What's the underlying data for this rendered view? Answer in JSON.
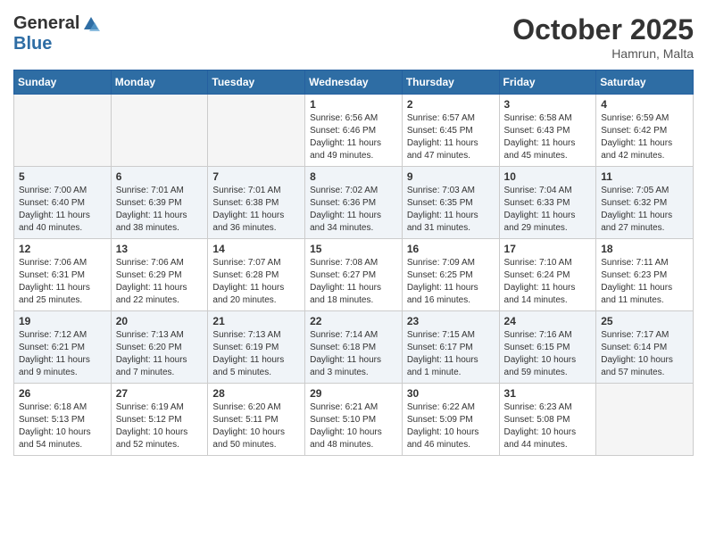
{
  "header": {
    "logo_general": "General",
    "logo_blue": "Blue",
    "month": "October 2025",
    "location": "Hamrun, Malta"
  },
  "days_of_week": [
    "Sunday",
    "Monday",
    "Tuesday",
    "Wednesday",
    "Thursday",
    "Friday",
    "Saturday"
  ],
  "weeks": [
    [
      {
        "day": "",
        "info": ""
      },
      {
        "day": "",
        "info": ""
      },
      {
        "day": "",
        "info": ""
      },
      {
        "day": "1",
        "info": "Sunrise: 6:56 AM\nSunset: 6:46 PM\nDaylight: 11 hours and 49 minutes."
      },
      {
        "day": "2",
        "info": "Sunrise: 6:57 AM\nSunset: 6:45 PM\nDaylight: 11 hours and 47 minutes."
      },
      {
        "day": "3",
        "info": "Sunrise: 6:58 AM\nSunset: 6:43 PM\nDaylight: 11 hours and 45 minutes."
      },
      {
        "day": "4",
        "info": "Sunrise: 6:59 AM\nSunset: 6:42 PM\nDaylight: 11 hours and 42 minutes."
      }
    ],
    [
      {
        "day": "5",
        "info": "Sunrise: 7:00 AM\nSunset: 6:40 PM\nDaylight: 11 hours and 40 minutes."
      },
      {
        "day": "6",
        "info": "Sunrise: 7:01 AM\nSunset: 6:39 PM\nDaylight: 11 hours and 38 minutes."
      },
      {
        "day": "7",
        "info": "Sunrise: 7:01 AM\nSunset: 6:38 PM\nDaylight: 11 hours and 36 minutes."
      },
      {
        "day": "8",
        "info": "Sunrise: 7:02 AM\nSunset: 6:36 PM\nDaylight: 11 hours and 34 minutes."
      },
      {
        "day": "9",
        "info": "Sunrise: 7:03 AM\nSunset: 6:35 PM\nDaylight: 11 hours and 31 minutes."
      },
      {
        "day": "10",
        "info": "Sunrise: 7:04 AM\nSunset: 6:33 PM\nDaylight: 11 hours and 29 minutes."
      },
      {
        "day": "11",
        "info": "Sunrise: 7:05 AM\nSunset: 6:32 PM\nDaylight: 11 hours and 27 minutes."
      }
    ],
    [
      {
        "day": "12",
        "info": "Sunrise: 7:06 AM\nSunset: 6:31 PM\nDaylight: 11 hours and 25 minutes."
      },
      {
        "day": "13",
        "info": "Sunrise: 7:06 AM\nSunset: 6:29 PM\nDaylight: 11 hours and 22 minutes."
      },
      {
        "day": "14",
        "info": "Sunrise: 7:07 AM\nSunset: 6:28 PM\nDaylight: 11 hours and 20 minutes."
      },
      {
        "day": "15",
        "info": "Sunrise: 7:08 AM\nSunset: 6:27 PM\nDaylight: 11 hours and 18 minutes."
      },
      {
        "day": "16",
        "info": "Sunrise: 7:09 AM\nSunset: 6:25 PM\nDaylight: 11 hours and 16 minutes."
      },
      {
        "day": "17",
        "info": "Sunrise: 7:10 AM\nSunset: 6:24 PM\nDaylight: 11 hours and 14 minutes."
      },
      {
        "day": "18",
        "info": "Sunrise: 7:11 AM\nSunset: 6:23 PM\nDaylight: 11 hours and 11 minutes."
      }
    ],
    [
      {
        "day": "19",
        "info": "Sunrise: 7:12 AM\nSunset: 6:21 PM\nDaylight: 11 hours and 9 minutes."
      },
      {
        "day": "20",
        "info": "Sunrise: 7:13 AM\nSunset: 6:20 PM\nDaylight: 11 hours and 7 minutes."
      },
      {
        "day": "21",
        "info": "Sunrise: 7:13 AM\nSunset: 6:19 PM\nDaylight: 11 hours and 5 minutes."
      },
      {
        "day": "22",
        "info": "Sunrise: 7:14 AM\nSunset: 6:18 PM\nDaylight: 11 hours and 3 minutes."
      },
      {
        "day": "23",
        "info": "Sunrise: 7:15 AM\nSunset: 6:17 PM\nDaylight: 11 hours and 1 minute."
      },
      {
        "day": "24",
        "info": "Sunrise: 7:16 AM\nSunset: 6:15 PM\nDaylight: 10 hours and 59 minutes."
      },
      {
        "day": "25",
        "info": "Sunrise: 7:17 AM\nSunset: 6:14 PM\nDaylight: 10 hours and 57 minutes."
      }
    ],
    [
      {
        "day": "26",
        "info": "Sunrise: 6:18 AM\nSunset: 5:13 PM\nDaylight: 10 hours and 54 minutes."
      },
      {
        "day": "27",
        "info": "Sunrise: 6:19 AM\nSunset: 5:12 PM\nDaylight: 10 hours and 52 minutes."
      },
      {
        "day": "28",
        "info": "Sunrise: 6:20 AM\nSunset: 5:11 PM\nDaylight: 10 hours and 50 minutes."
      },
      {
        "day": "29",
        "info": "Sunrise: 6:21 AM\nSunset: 5:10 PM\nDaylight: 10 hours and 48 minutes."
      },
      {
        "day": "30",
        "info": "Sunrise: 6:22 AM\nSunset: 5:09 PM\nDaylight: 10 hours and 46 minutes."
      },
      {
        "day": "31",
        "info": "Sunrise: 6:23 AM\nSunset: 5:08 PM\nDaylight: 10 hours and 44 minutes."
      },
      {
        "day": "",
        "info": ""
      }
    ]
  ]
}
